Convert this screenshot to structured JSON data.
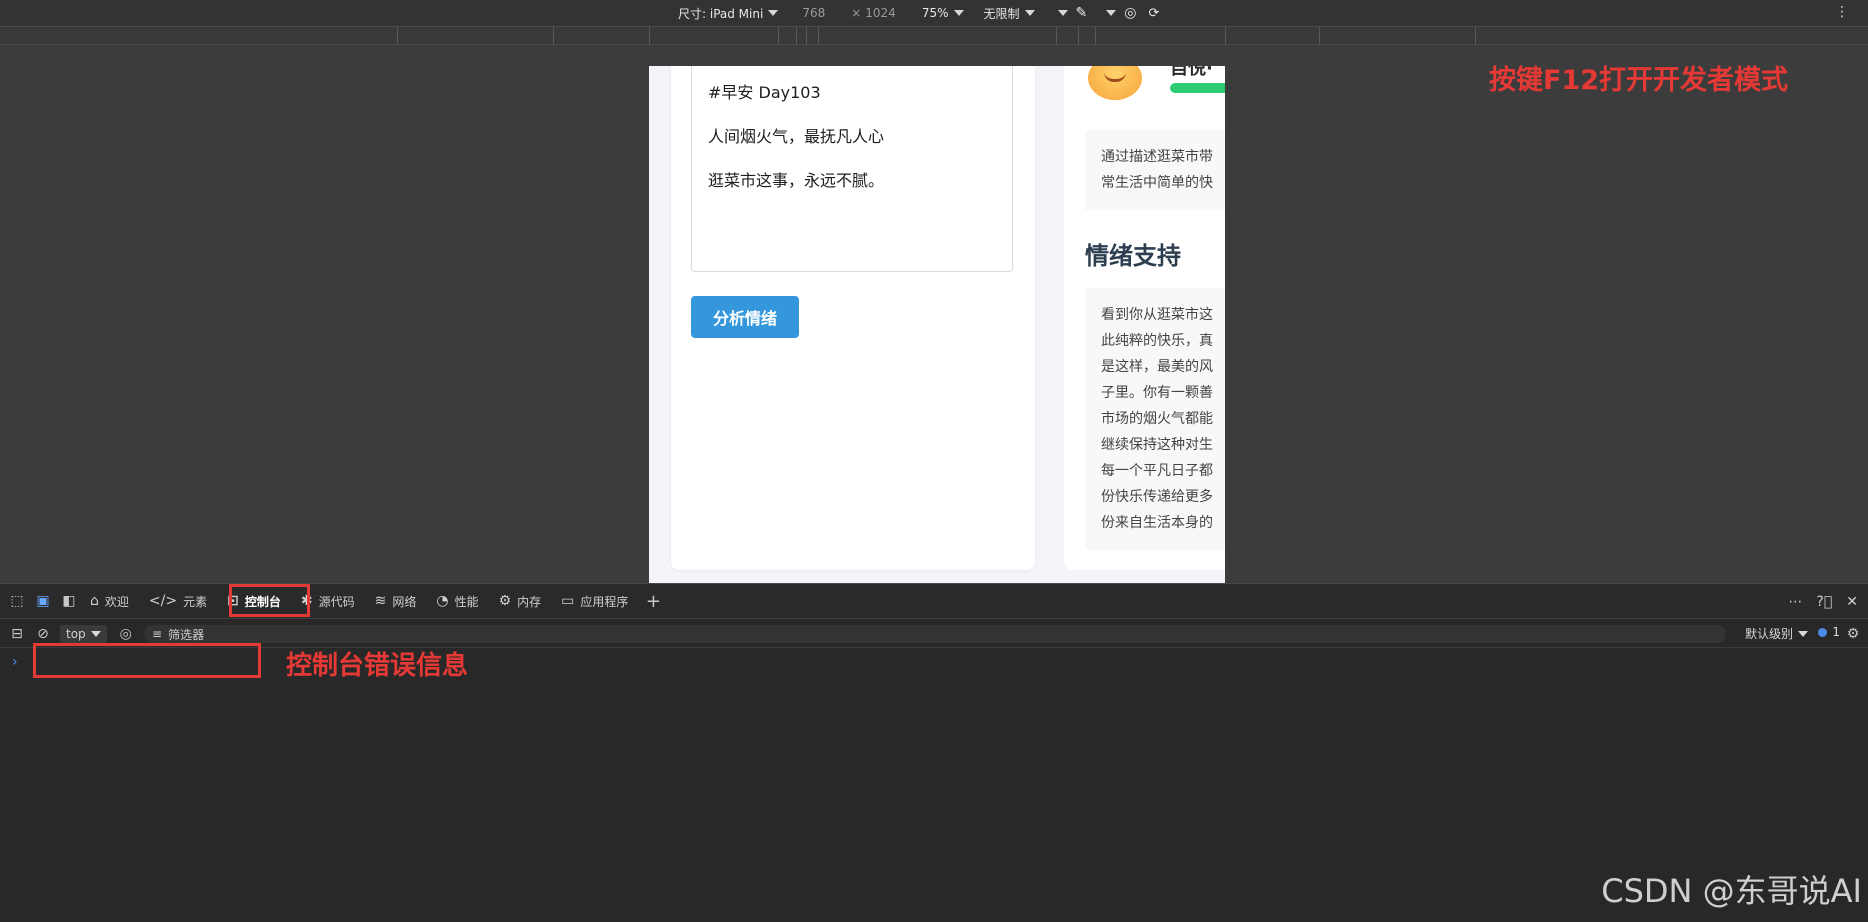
{
  "device_toolbar": {
    "dimensions_label": "尺寸: iPad Mini",
    "width": "768",
    "times": "×",
    "height": "1024",
    "zoom": "75%",
    "throttle": "无限制"
  },
  "page": {
    "textarea_lines": [
      "#早安 Day103",
      "人间烟火气，最抚凡人心",
      "逛菜市这事，永远不腻。"
    ],
    "analyze_button": "分析情绪",
    "emotion_label": "自悦·",
    "description": [
      "通过描述逛菜市带",
      "常生活中简单的快"
    ],
    "support_title": "情绪支持",
    "support_lines": [
      "看到你从逛菜市这",
      "此纯粹的快乐，真",
      "是这样，最美的风",
      "子里。你有一颗善",
      "市场的烟火气都能",
      "继续保持这种对生",
      "每一个平凡日子都",
      "份快乐传递给更多",
      "份来自生活本身的"
    ]
  },
  "annotations": {
    "f12": "按键F12打开开发者模式",
    "console_error": "控制台错误信息"
  },
  "devtools": {
    "tabs": [
      {
        "label": "欢迎",
        "icon": "home-icon"
      },
      {
        "label": "元素",
        "icon": "code-icon"
      },
      {
        "label": "控制台",
        "icon": "console-icon"
      },
      {
        "label": "源代码",
        "icon": "bug-icon"
      },
      {
        "label": "网络",
        "icon": "wifi-icon"
      },
      {
        "label": "性能",
        "icon": "gauge-icon"
      },
      {
        "label": "内存",
        "icon": "gear-icon"
      },
      {
        "label": "应用程序",
        "icon": "app-icon"
      }
    ],
    "context": "top",
    "filter_placeholder": "筛选器",
    "levels": "默认级别",
    "issues_count": "1",
    "prompt": "›"
  },
  "watermark": "CSDN @东哥说AI"
}
